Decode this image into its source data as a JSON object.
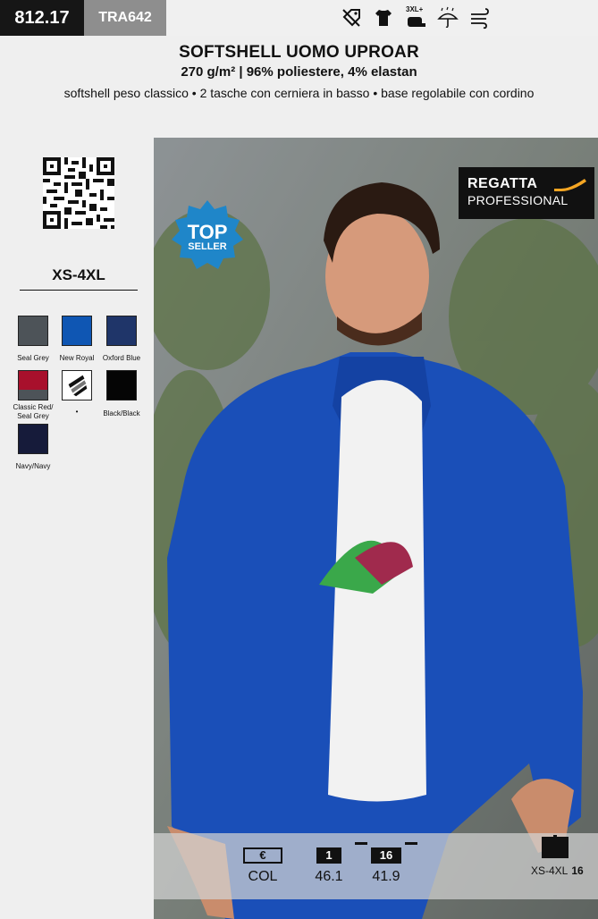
{
  "header": {
    "page_number": "812.17",
    "product_code": "TRA642",
    "title": "SOFTSHELL UOMO UPROAR",
    "subtitle": "270 g/m² | 96% poliestere, 4% elastan",
    "description": "softshell peso classico • 2 tasche con cerniera in basso • base regolabile con cordino",
    "feature_icons": [
      "discount-tag-icon",
      "tshirt-icon",
      "size-tag-icon",
      "umbrella-rain-icon",
      "wind-icon"
    ],
    "size_tag_label": "3XL+"
  },
  "sidebar": {
    "size_range": "XS-4XL",
    "colors": [
      {
        "name": "Seal Grey",
        "hex": "#4d5358"
      },
      {
        "name": "New Royal",
        "hex": "#0f56b3"
      },
      {
        "name": "Oxford Blue",
        "hex": "#1f3569"
      },
      {
        "name": "Classic Red/ Seal Grey",
        "hex": "#a8102c",
        "hex2": "#4d5358"
      },
      {
        "name": "•",
        "hex": "#ffffff"
      },
      {
        "name": "Black/Black",
        "hex": "#050505"
      },
      {
        "name": "Navy/Navy",
        "hex": "#161b3a"
      }
    ]
  },
  "badges": {
    "top_seller_line1": "TOP",
    "top_seller_line2": "SELLER",
    "brand_name": "REGATTA",
    "brand_sub": "PROFESSIONAL"
  },
  "pricing": {
    "currency_symbol": "€",
    "currency_label": "COL",
    "tier1_qty": "1",
    "tier1_price": "46.1",
    "tier2_qty": "16",
    "tier2_price": "41.9",
    "carton_sizes": "XS-4XL",
    "carton_qty": "16"
  }
}
